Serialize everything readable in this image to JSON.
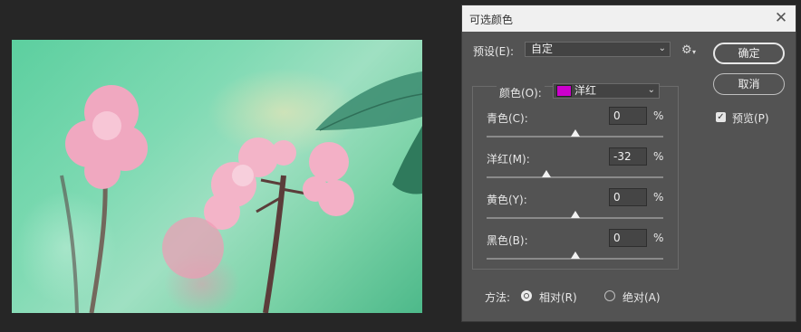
{
  "dialog": {
    "title": "可选颜色",
    "preset_label": "预设(E):",
    "preset_value": "自定",
    "ok_label": "确定",
    "cancel_label": "取消",
    "preview_label": "预览(P)",
    "preview_checked": true,
    "colors_label": "颜色(O):",
    "colors_value": "洋红",
    "colors_swatch": "#cc00cc",
    "sliders": [
      {
        "label": "青色(C):",
        "value": "0",
        "unit": "%",
        "level": 0.5
      },
      {
        "label": "洋红(M):",
        "value": "-32",
        "unit": "%",
        "level": 0.34
      },
      {
        "label": "黄色(Y):",
        "value": "0",
        "unit": "%",
        "level": 0.5
      },
      {
        "label": "黑色(B):",
        "value": "0",
        "unit": "%",
        "level": 0.5
      }
    ],
    "method_label": "方法:",
    "method_relative": "相对(R)",
    "method_absolute": "绝对(A)",
    "method_selected": "relative"
  }
}
